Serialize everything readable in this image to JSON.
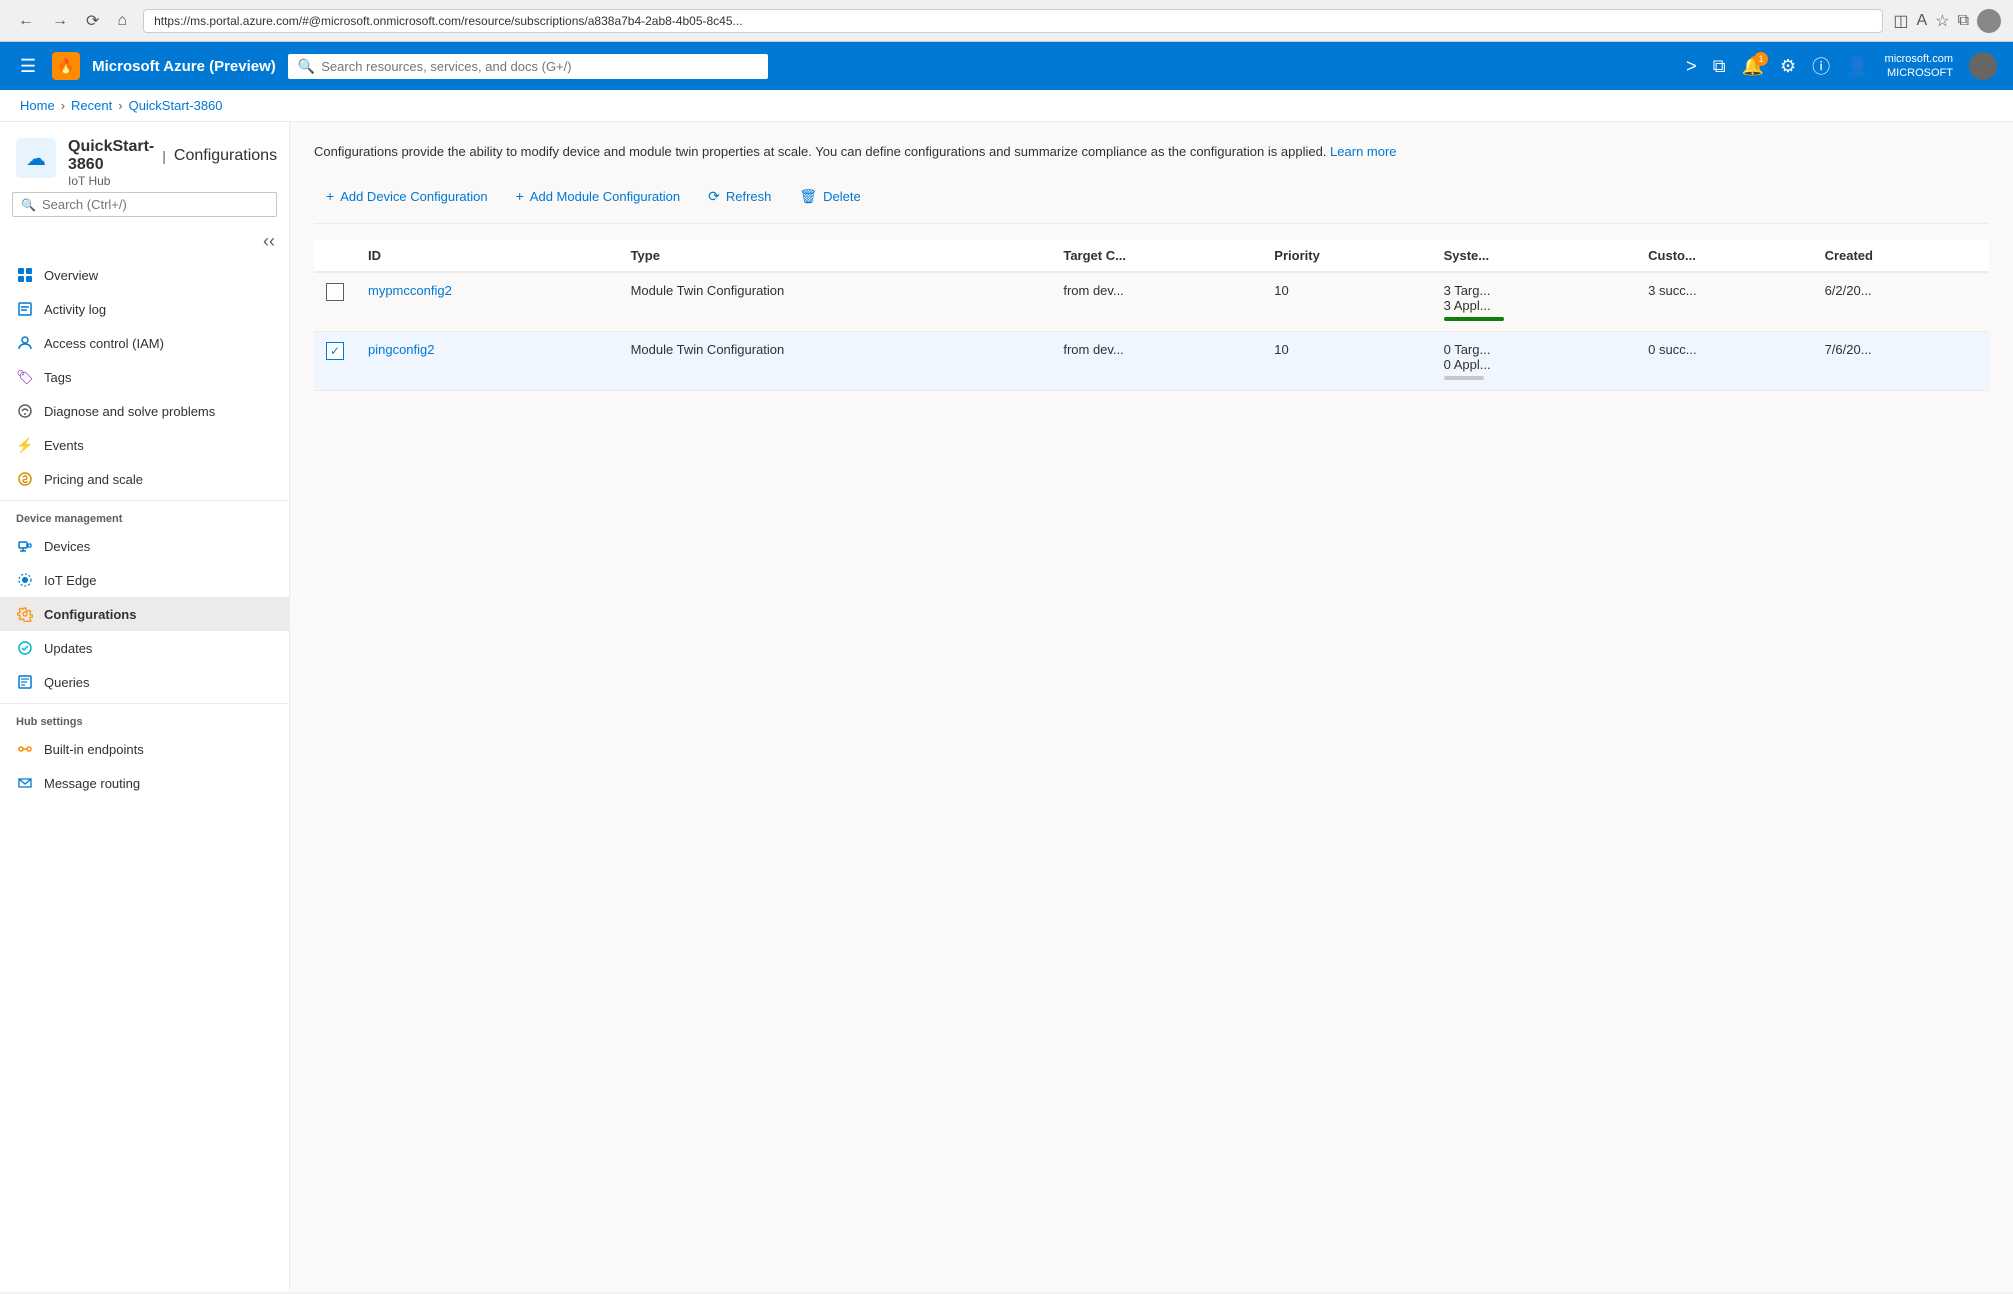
{
  "browser": {
    "url": "https://ms.portal.azure.com/#@microsoft.onmicrosoft.com/resource/subscriptions/a838a7b4-2ab8-4b05-8c45...",
    "nav": {
      "back": "◀",
      "forward": "▶",
      "refresh": "↺",
      "home": "⌂"
    }
  },
  "topbar": {
    "brand": "Microsoft Azure (Preview)",
    "search_placeholder": "Search resources, services, and docs (G+/)",
    "user_domain": "microsoft.com",
    "user_org": "MICROSOFT",
    "notification_count": "1"
  },
  "breadcrumb": {
    "items": [
      "Home",
      "Recent",
      "QuickStart-3860"
    ]
  },
  "resource": {
    "name": "QuickStart-3860",
    "type": "IoT Hub",
    "section": "Configurations"
  },
  "description": "Configurations provide the ability to modify device and module twin properties at scale. You can define configurations and summarize compliance as the configuration is applied.",
  "learn_more": "Learn more",
  "toolbar": {
    "add_device_config": "Add Device Configuration",
    "add_module_config": "Add Module Configuration",
    "refresh": "Refresh",
    "delete": "Delete"
  },
  "table": {
    "columns": [
      "ID",
      "Type",
      "Target C...",
      "Priority",
      "Syste...",
      "Custo...",
      "Created"
    ],
    "rows": [
      {
        "id": "mypmcconfig2",
        "type": "Module Twin Configuration",
        "target_condition": "from dev...",
        "priority": "10",
        "system_metrics": "3 Targ...\n3 Appl...",
        "custom_metrics": "3 succ...",
        "created": "6/2/20...",
        "progress_color": "green",
        "progress_width": "60",
        "selected": false,
        "checked": false
      },
      {
        "id": "pingconfig2",
        "type": "Module Twin Configuration",
        "target_condition": "from dev...",
        "priority": "10",
        "system_metrics": "0 Targ...\n0 Appl...",
        "custom_metrics": "0 succ...",
        "created": "7/6/20...",
        "progress_color": "gray",
        "progress_width": "40",
        "selected": true,
        "checked": true
      }
    ]
  },
  "sidebar": {
    "search_placeholder": "Search (Ctrl+/)",
    "nav_items": [
      {
        "label": "Overview",
        "icon": "overview",
        "active": false,
        "section": ""
      },
      {
        "label": "Activity log",
        "icon": "activity",
        "active": false,
        "section": ""
      },
      {
        "label": "Access control (IAM)",
        "icon": "iam",
        "active": false,
        "section": ""
      },
      {
        "label": "Tags",
        "icon": "tags",
        "active": false,
        "section": ""
      },
      {
        "label": "Diagnose and solve problems",
        "icon": "diagnose",
        "active": false,
        "section": ""
      },
      {
        "label": "Events",
        "icon": "events",
        "active": false,
        "section": ""
      },
      {
        "label": "Pricing and scale",
        "icon": "pricing",
        "active": false,
        "section": ""
      },
      {
        "label": "Devices",
        "icon": "devices",
        "active": false,
        "section": "Device management"
      },
      {
        "label": "IoT Edge",
        "icon": "iot-edge",
        "active": false,
        "section": ""
      },
      {
        "label": "Configurations",
        "icon": "configurations",
        "active": true,
        "section": ""
      },
      {
        "label": "Updates",
        "icon": "updates",
        "active": false,
        "section": ""
      },
      {
        "label": "Queries",
        "icon": "queries",
        "active": false,
        "section": ""
      },
      {
        "label": "Built-in endpoints",
        "icon": "endpoints",
        "active": false,
        "section": "Hub settings"
      },
      {
        "label": "Message routing",
        "icon": "message-routing",
        "active": false,
        "section": ""
      }
    ]
  }
}
